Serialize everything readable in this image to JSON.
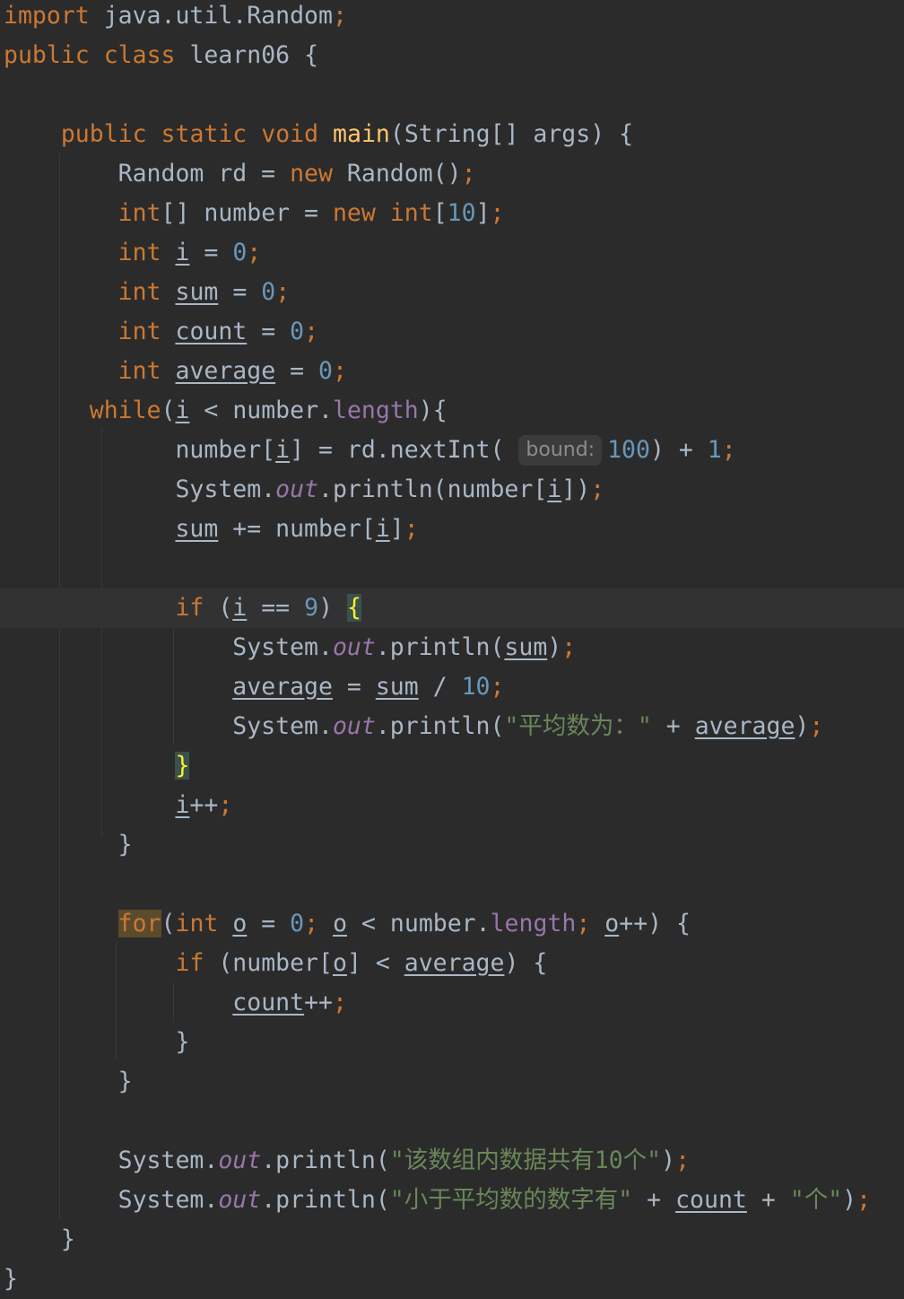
{
  "editor": {
    "language": "Java",
    "hint_label": "bound:",
    "colors": {
      "background": "#2b2b2b",
      "keyword": "#cc7832",
      "method": "#ffc66d",
      "number": "#6897bb",
      "string": "#6a8759",
      "field": "#9876aa",
      "text": "#a9b7c6"
    },
    "lines": [
      "import java.util.Random;",
      "public class learn06 {",
      "",
      "    public static void main(String[] args) {",
      "        Random rd = new Random();",
      "        int[] number = new int[10];",
      "        int i = 0;",
      "        int sum = 0;",
      "        int count = 0;",
      "        int average = 0;",
      "      while(i < number.length){",
      "            number[i] = rd.nextInt( bound: 100) + 1;",
      "            System.out.println(number[i]);",
      "            sum += number[i];",
      "",
      "            if (i == 9) {",
      "                System.out.println(sum);",
      "                average = sum / 10;",
      "                System.out.println(\"平均数为：\" + average);",
      "            }",
      "            i++;",
      "        }",
      "",
      "        for(int o = 0; o < number.length; o++) {",
      "            if (number[o] < average) {",
      "                count++;",
      "            }",
      "        }",
      "",
      "        System.out.println(\"该数组内数据共有10个\");",
      "        System.out.println(\"小于平均数的数字有\" + count + \"个\");",
      "    }",
      "}"
    ],
    "current_line": 16
  }
}
